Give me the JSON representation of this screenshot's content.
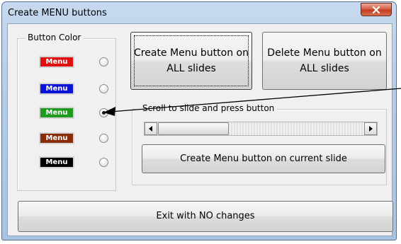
{
  "window": {
    "title": "Create MENU buttons",
    "close_glyph": "x"
  },
  "color_group": {
    "label": "Button Color",
    "options": [
      {
        "label": "Menu",
        "color": "#e01010",
        "selected": false
      },
      {
        "label": "Menu",
        "color": "#0a14d6",
        "selected": false
      },
      {
        "label": "Menu",
        "color": "#1e9a1e",
        "selected": true
      },
      {
        "label": "Menu",
        "color": "#8a2c08",
        "selected": false
      },
      {
        "label": "Menu",
        "color": "#000000",
        "selected": false
      }
    ]
  },
  "buttons": {
    "create_all": "Create Menu button on ALL slides",
    "delete_all": "Delete Menu button on ALL slides",
    "create_current": "Create Menu button on current slide",
    "exit": "Exit with NO changes"
  },
  "scroll_group": {
    "label": "Scroll to slide and press button",
    "left_arrow": "◀",
    "right_arrow": "▶"
  }
}
